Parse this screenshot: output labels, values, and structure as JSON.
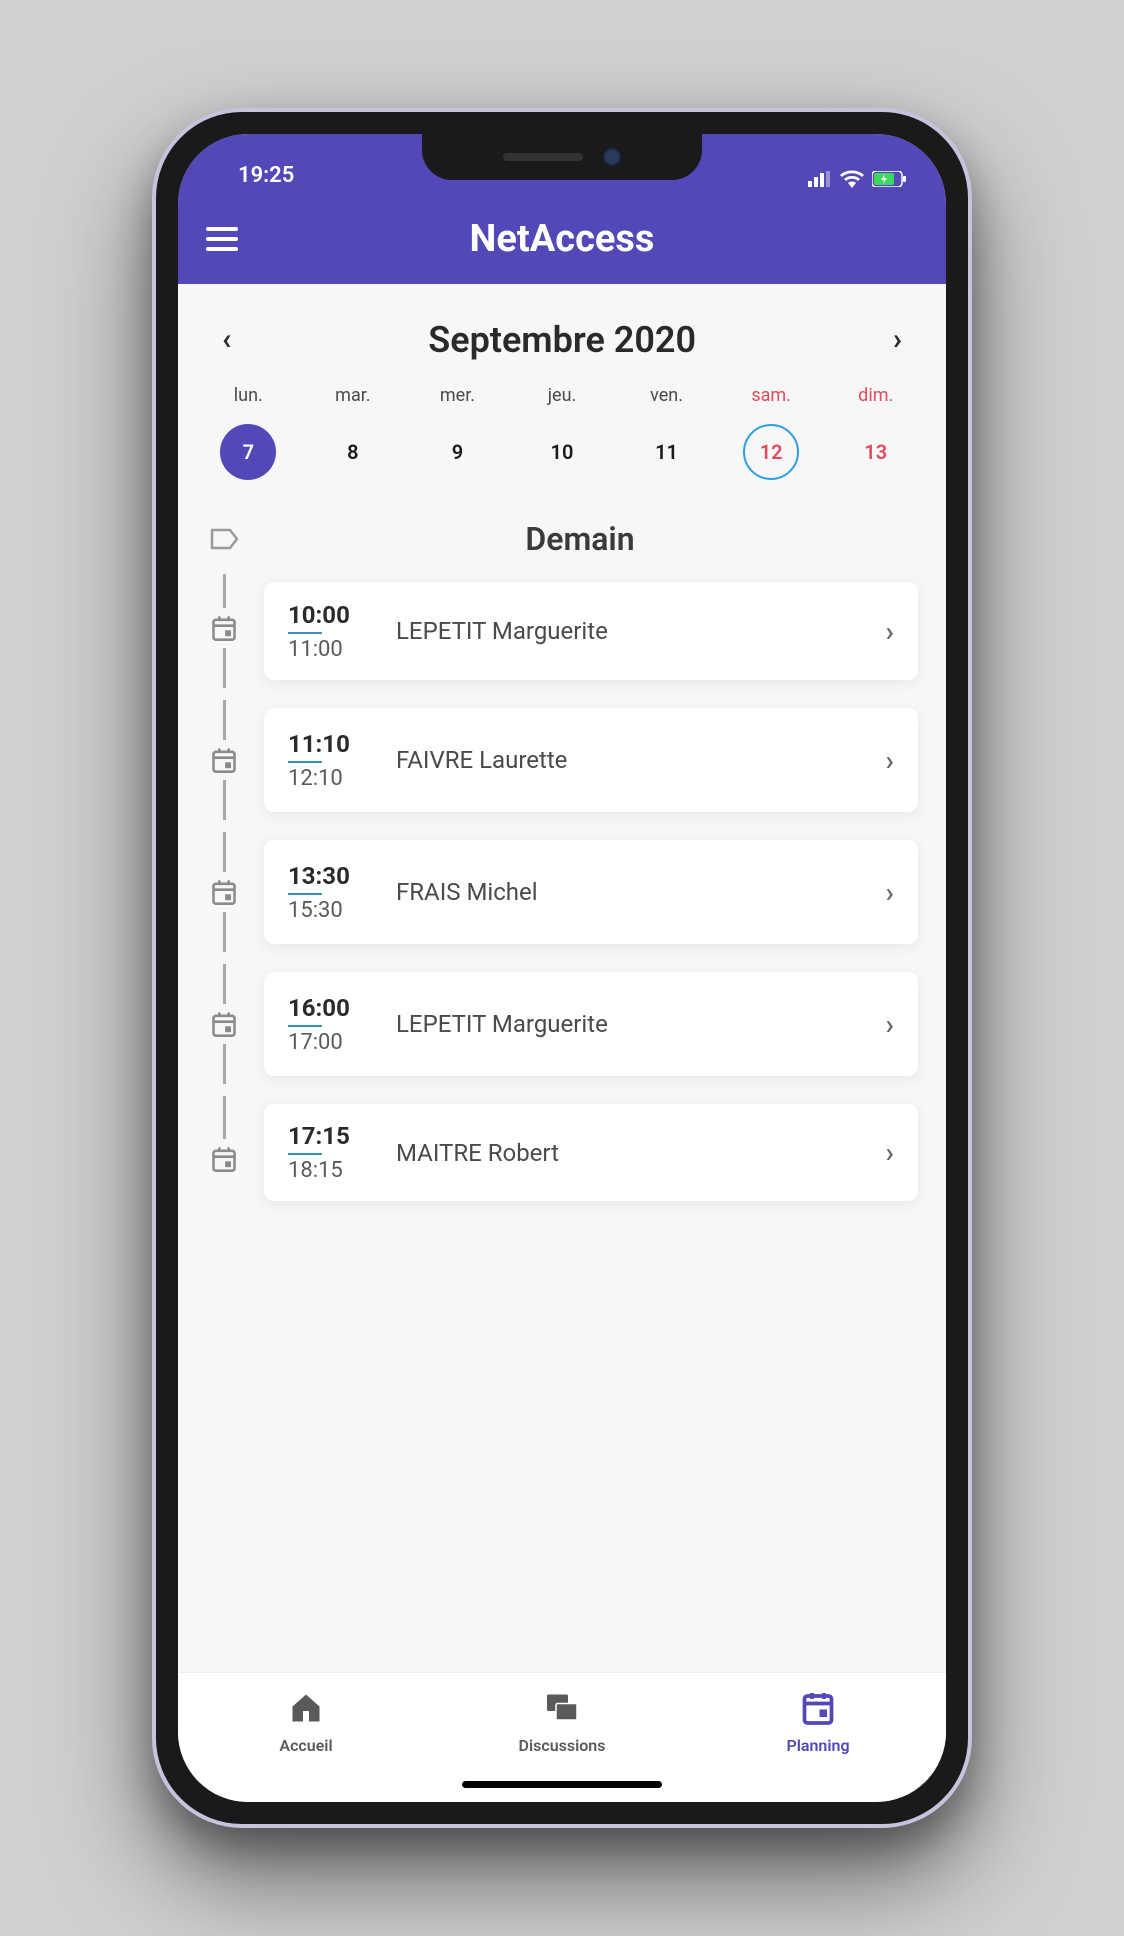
{
  "statusbar": {
    "time": "19:25"
  },
  "header": {
    "title": "NetAccess"
  },
  "calendar": {
    "month_label": "Septembre 2020",
    "days": [
      {
        "name": "lun.",
        "num": "7",
        "weekend": false,
        "selected": true,
        "today": false
      },
      {
        "name": "mar.",
        "num": "8",
        "weekend": false,
        "selected": false,
        "today": false
      },
      {
        "name": "mer.",
        "num": "9",
        "weekend": false,
        "selected": false,
        "today": false
      },
      {
        "name": "jeu.",
        "num": "10",
        "weekend": false,
        "selected": false,
        "today": false
      },
      {
        "name": "ven.",
        "num": "11",
        "weekend": false,
        "selected": false,
        "today": false
      },
      {
        "name": "sam.",
        "num": "12",
        "weekend": true,
        "selected": false,
        "today": true
      },
      {
        "name": "dim.",
        "num": "13",
        "weekend": true,
        "selected": false,
        "today": false
      }
    ]
  },
  "section": {
    "title": "Demain"
  },
  "events": [
    {
      "start": "10:00",
      "end": "11:00",
      "title": "LEPETIT Marguerite"
    },
    {
      "start": "11:10",
      "end": "12:10",
      "title": "FAIVRE Laurette"
    },
    {
      "start": "13:30",
      "end": "15:30",
      "title": "FRAIS Michel"
    },
    {
      "start": "16:00",
      "end": "17:00",
      "title": "LEPETIT Marguerite"
    },
    {
      "start": "17:15",
      "end": "18:15",
      "title": "MAITRE Robert"
    }
  ],
  "nav": {
    "items": [
      {
        "label": "Accueil",
        "icon": "home-icon",
        "active": false
      },
      {
        "label": "Discussions",
        "icon": "chat-icon",
        "active": false
      },
      {
        "label": "Planning",
        "icon": "calendar-icon",
        "active": true
      }
    ]
  }
}
